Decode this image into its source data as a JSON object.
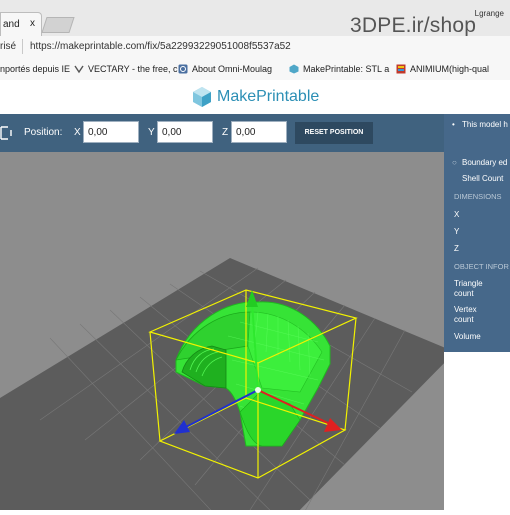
{
  "browser": {
    "active_tab_label": "and",
    "close_tab": "x",
    "language_label": "Lgrange",
    "secure_label": "risé",
    "url": "https://makeprintable.com/fix/5a22993229051008f5537a52",
    "bookmarks": [
      {
        "label": "nportés depuis IE",
        "icon": "folder-icon"
      },
      {
        "label": "VECTARY - the free, c",
        "icon": "vectary-icon"
      },
      {
        "label": "About Omni-Moulag",
        "icon": "omni-icon"
      },
      {
        "label": "MakePrintable: STL a",
        "icon": "makeprintable-icon"
      },
      {
        "label": "ANIMIUM(high-qual",
        "icon": "animium-icon"
      }
    ]
  },
  "watermark": "3DPE.ir/shop",
  "site": {
    "logo_text": "MakePrintable",
    "brand_color": "#2c8fb5"
  },
  "toolbar": {
    "position_label": "Position:",
    "x_label": "X",
    "y_label": "Y",
    "z_label": "Z",
    "x_value": "0,00",
    "y_value": "0,00",
    "z_value": "0,00",
    "reset_label": "RESET POSITION"
  },
  "panel": {
    "header": "This model h",
    "items_top": [
      "Boundary ed",
      "Shell Count"
    ],
    "dimensions_header": "DIMENSIONS",
    "dimensions": [
      "X",
      "Y",
      "Z"
    ],
    "object_header": "OBJECT INFOR",
    "object_items": [
      {
        "line1": "Triangle",
        "line2": "count"
      },
      {
        "line1": "Vertex",
        "line2": "count"
      },
      {
        "line1": "Volume",
        "line2": ""
      }
    ]
  },
  "viewport": {
    "model_color": "#35e035",
    "bbox_color": "#f2f200",
    "axes": [
      "x-axis-red",
      "y-axis-green",
      "z-axis-blue"
    ]
  }
}
